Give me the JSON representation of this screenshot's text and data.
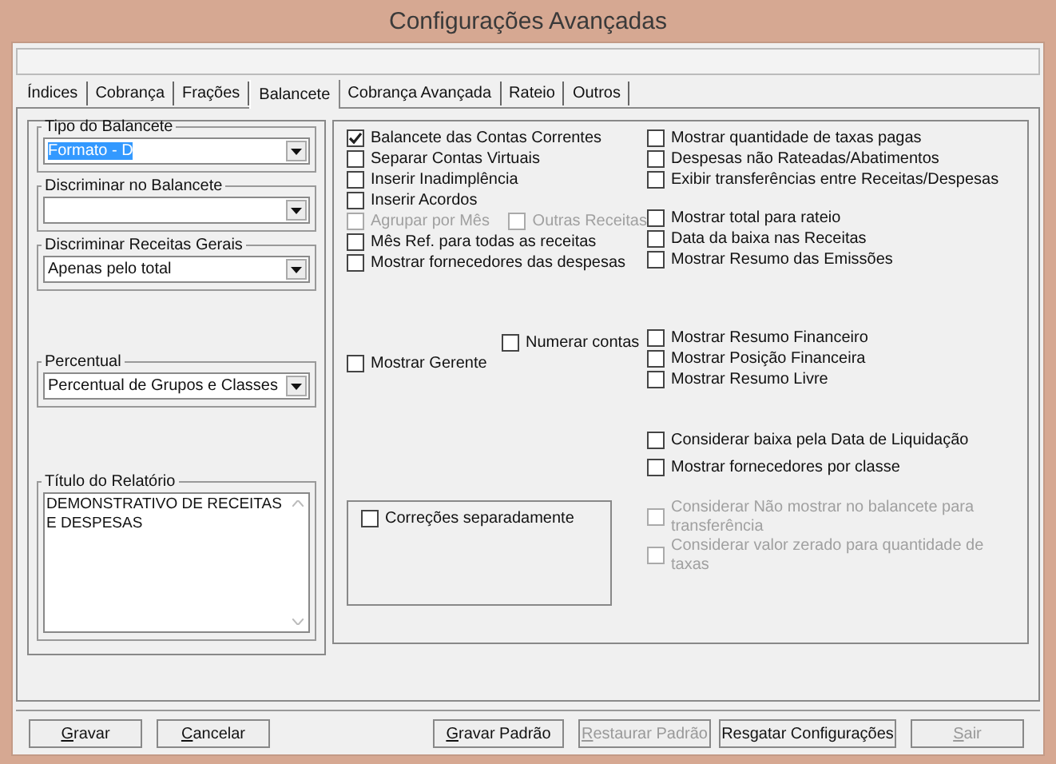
{
  "window": {
    "title": "Configurações Avançadas"
  },
  "tabs": [
    {
      "label": "Índices",
      "selected": false
    },
    {
      "label": "Cobrança",
      "selected": false
    },
    {
      "label": "Frações",
      "selected": false
    },
    {
      "label": "Balancete",
      "selected": true
    },
    {
      "label": "Cobrança Avançada",
      "selected": false
    },
    {
      "label": "Rateio",
      "selected": false
    },
    {
      "label": "Outros",
      "selected": false
    }
  ],
  "left_panel": {
    "combos": [
      {
        "label": "Tipo do Balancete",
        "value": "Formato - D",
        "value_selected": true
      },
      {
        "label": "Discriminar no Balancete"
      },
      {
        "label": "Discriminar Receitas Gerais",
        "value": "Apenas pelo total",
        "value_selected": false
      },
      {
        "label": "Percentual",
        "value": "Percentual de Grupos e Classes",
        "value_selected": false
      }
    ],
    "report_title": {
      "label": "Título do Relatório",
      "value": "DEMONSTRATIVO DE RECEITAS E DESPESAS"
    }
  },
  "options_left": [
    [
      {
        "kind": "check",
        "label": "Balancete das Contas Correntes",
        "checked": true,
        "disabled": false
      },
      {
        "kind": "check",
        "label": "Separar Contas Virtuais",
        "checked": false,
        "disabled": false
      },
      {
        "kind": "check",
        "label": "Inserir Inadimplência",
        "checked": false,
        "disabled": false
      },
      {
        "kind": "check",
        "label": "Inserir Acordos",
        "checked": false,
        "disabled": false
      },
      {
        "kind": "pair",
        "options": [
          {
            "label": "Agrupar por Mês",
            "checked": false,
            "disabled": true
          },
          {
            "label": "Outras Receitas",
            "checked": false,
            "disabled": true
          }
        ]
      },
      {
        "kind": "check",
        "label": "Mês Ref. para todas as receitas",
        "checked": false,
        "disabled": false
      },
      {
        "kind": "check",
        "label": "Mostrar fornecedores das despesas",
        "checked": false,
        "disabled": false
      }
    ],
    [
      {
        "kind": "indented",
        "label": "Numerar contas",
        "checked": false,
        "disabled": false
      },
      {
        "kind": "check",
        "label": "Mostrar Gerente",
        "checked": false,
        "disabled": false
      }
    ],
    [
      {
        "kind": "group",
        "label": "Correções separadamente",
        "checked": false,
        "disabled": false
      }
    ]
  ],
  "options_right": [
    [
      {
        "kind": "check",
        "label": "Mostrar quantidade de taxas pagas",
        "checked": false,
        "disabled": false
      },
      {
        "kind": "check",
        "label": "Despesas não Rateadas/Abatimentos",
        "checked": false,
        "disabled": false
      },
      {
        "kind": "check",
        "label": "Exibir transferências entre Receitas/Despesas",
        "checked": false,
        "disabled": false
      }
    ],
    [
      {
        "kind": "check",
        "label": "Mostrar total para rateio",
        "checked": false,
        "disabled": false
      },
      {
        "kind": "check",
        "label": "Data da baixa nas Receitas",
        "checked": false,
        "disabled": false
      },
      {
        "kind": "check",
        "label": "Mostrar Resumo das Emissões",
        "checked": false,
        "disabled": false
      }
    ],
    [
      {
        "kind": "check",
        "label": "Mostrar Resumo Financeiro",
        "checked": false,
        "disabled": false
      },
      {
        "kind": "check",
        "label": "Mostrar Posição Financeira",
        "checked": false,
        "disabled": false
      },
      {
        "kind": "check",
        "label": "Mostrar Resumo Livre",
        "checked": false,
        "disabled": false
      }
    ],
    [
      {
        "kind": "spaced",
        "label": "Considerar baixa pela Data de Liquidação",
        "checked": false,
        "disabled": false
      },
      {
        "kind": "spaced",
        "label": "Mostrar fornecedores por classe",
        "checked": false,
        "disabled": false
      }
    ],
    [
      {
        "kind": "wrapped",
        "label": "Considerar Não mostrar no balancete para transferência",
        "checked": false,
        "disabled": true
      },
      {
        "kind": "wrapped",
        "label": "Considerar valor zerado para quantidade de taxas",
        "checked": false,
        "disabled": true
      }
    ]
  ],
  "buttons": [
    {
      "label": "Gravar",
      "disabled": false,
      "access_key": true
    },
    {
      "label": "Cancelar",
      "disabled": false,
      "access_key": true
    },
    {
      "label": "Gravar Padrão",
      "disabled": false,
      "access_key": true
    },
    {
      "label": "Restaurar Padrão",
      "disabled": true,
      "access_key": true
    },
    {
      "label": "Resgatar Configurações",
      "disabled": false,
      "access_key": false
    },
    {
      "label": "Sair",
      "disabled": true,
      "access_key": true
    }
  ]
}
